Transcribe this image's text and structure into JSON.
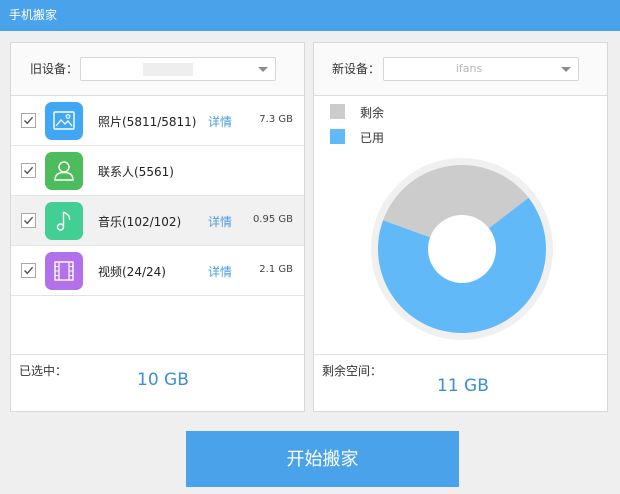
{
  "window": {
    "title": "手机搬家"
  },
  "old_device": {
    "label": "旧设备：",
    "selected": ""
  },
  "new_device": {
    "label": "新设备：",
    "selected": "ifans"
  },
  "items": [
    {
      "name": "照片(5811/5811)",
      "detail": "详情",
      "size": "7.3 GB",
      "checked": true,
      "icon": "photo-icon",
      "color": "#3fa7f3"
    },
    {
      "name": "联系人(5561)",
      "detail": "",
      "size": "",
      "checked": true,
      "icon": "contact-icon",
      "color": "#4cbc5c"
    },
    {
      "name": "音乐(102/102)",
      "detail": "详情",
      "size": "0.95 GB",
      "checked": true,
      "icon": "music-icon",
      "color": "#43cf94"
    },
    {
      "name": "视频(24/24)",
      "detail": "详情",
      "size": "2.1 GB",
      "checked": true,
      "icon": "video-icon",
      "color": "#b270ea"
    }
  ],
  "selected_summary": {
    "label": "已选中：",
    "value": "10 GB"
  },
  "free_summary": {
    "label": "剩余空间：",
    "value": "11 GB"
  },
  "chart_data": {
    "type": "pie",
    "categories": [
      "剩余",
      "已用"
    ],
    "values": [
      34,
      66
    ],
    "colors": [
      "#cccccc",
      "#62b9f7"
    ],
    "legend": "top-left"
  },
  "start_button": {
    "label": "开始搬家"
  }
}
